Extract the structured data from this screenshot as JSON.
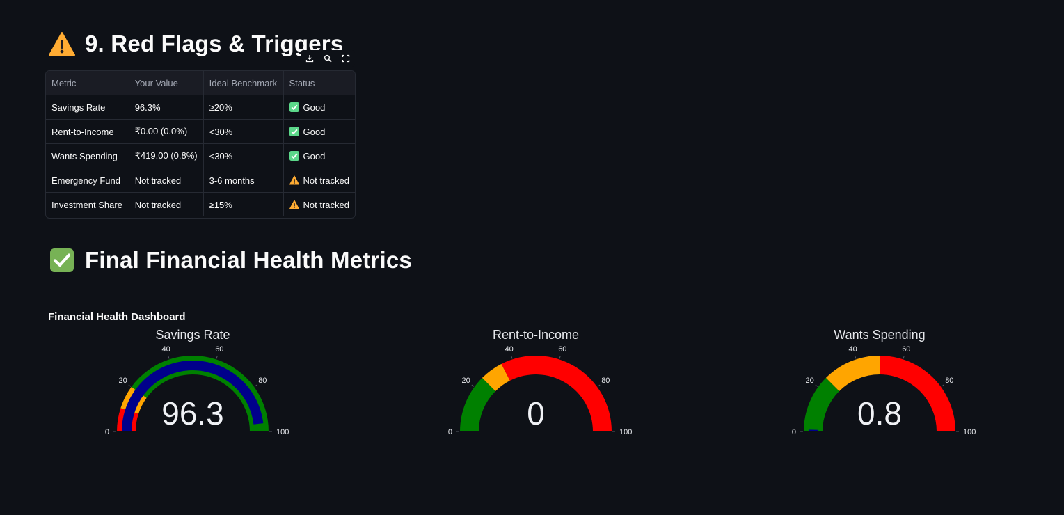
{
  "sections": {
    "red_flags_title": "9. Red Flags & Triggers",
    "health_metrics_title": "Final Financial Health Metrics"
  },
  "toolbar": {
    "icons": [
      "download-icon",
      "search-icon",
      "fullscreen-icon"
    ]
  },
  "table": {
    "headers": [
      "Metric",
      "Your Value",
      "Ideal Benchmark",
      "Status"
    ],
    "rows": [
      {
        "metric": "Savings Rate",
        "value": "96.3%",
        "benchmark": "≥20%",
        "status": "Good",
        "status_icon": "check-icon"
      },
      {
        "metric": "Rent-to-Income",
        "value": "₹0.00 (0.0%)",
        "benchmark": "<30%",
        "status": "Good",
        "status_icon": "check-icon"
      },
      {
        "metric": "Wants Spending",
        "value": "₹419.00 (0.8%)",
        "benchmark": "<30%",
        "status": "Good",
        "status_icon": "check-icon"
      },
      {
        "metric": "Emergency Fund",
        "value": "Not tracked",
        "benchmark": "3-6 months",
        "status": "Not tracked",
        "status_icon": "warning-icon"
      },
      {
        "metric": "Investment Share",
        "value": "Not tracked",
        "benchmark": "≥15%",
        "status": "Not tracked",
        "status_icon": "warning-icon"
      }
    ]
  },
  "dashboard": {
    "title": "Financial Health Dashboard"
  },
  "colors": {
    "background": "#0e1117",
    "good": "#008000",
    "warn": "#ffa500",
    "bad": "#ff0000",
    "bar": "#00008b"
  },
  "chart_data": [
    {
      "type": "gauge",
      "title": "Savings Rate",
      "value": 96.3,
      "value_label": "96.3",
      "range": [
        0,
        100
      ],
      "ticks": [
        "0",
        "20",
        "40",
        "60",
        "80",
        "100"
      ],
      "steps": [
        {
          "from": 0,
          "to": 10,
          "color": "#ff0000"
        },
        {
          "from": 10,
          "to": 20,
          "color": "#ffa500"
        },
        {
          "from": 20,
          "to": 100,
          "color": "#008000"
        }
      ]
    },
    {
      "type": "gauge",
      "title": "Rent-to-Income",
      "value": 0,
      "value_label": "0",
      "range": [
        0,
        100
      ],
      "ticks": [
        "0",
        "20",
        "40",
        "60",
        "80",
        "100"
      ],
      "steps": [
        {
          "from": 0,
          "to": 25,
          "color": "#008000"
        },
        {
          "from": 25,
          "to": 35,
          "color": "#ffa500"
        },
        {
          "from": 35,
          "to": 100,
          "color": "#ff0000"
        }
      ]
    },
    {
      "type": "gauge",
      "title": "Wants Spending",
      "value": 0.8,
      "value_label": "0.8",
      "range": [
        0,
        100
      ],
      "ticks": [
        "0",
        "20",
        "40",
        "60",
        "80",
        "100"
      ],
      "steps": [
        {
          "from": 0,
          "to": 25,
          "color": "#008000"
        },
        {
          "from": 25,
          "to": 50,
          "color": "#ffa500"
        },
        {
          "from": 50,
          "to": 100,
          "color": "#ff0000"
        }
      ]
    }
  ]
}
